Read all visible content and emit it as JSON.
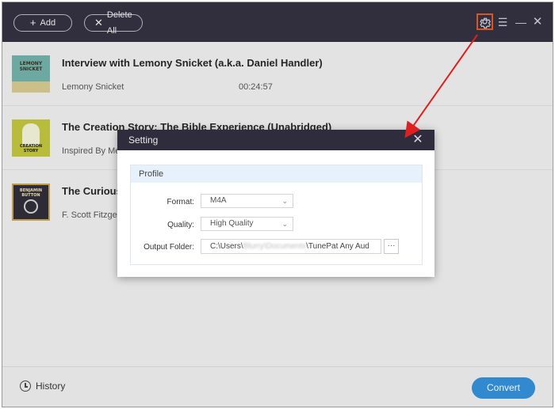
{
  "toolbar": {
    "add_label": "Add",
    "delete_all_label": "Delete All",
    "add_icon": "plus-icon",
    "delete_icon": "x-icon",
    "settings_icon": "gear-icon",
    "menu_icon": "hamburger-icon",
    "minimize_icon": "minimize-icon",
    "close_icon": "close-icon",
    "settings_highlight_color": "#e8561f"
  },
  "tracks": [
    {
      "title": "Interview with Lemony Snicket (a.k.a. Daniel Handler)",
      "author": "Lemony Snicket",
      "duration": "00:24:57",
      "cover_text": "LEMONY SNICKET"
    },
    {
      "title": "The Creation Story: The Bible Experience (Unabridged)",
      "author": "Inspired By Me",
      "duration": "",
      "cover_text": "CREATION STORY"
    },
    {
      "title": "The Curious",
      "author": "F. Scott Fitzgera",
      "duration": "",
      "cover_text": "BENJAMIN BUTTON"
    }
  ],
  "dialog": {
    "title": "Setting",
    "profile_header": "Profile",
    "format_label": "Format:",
    "format_value": "M4A",
    "quality_label": "Quality:",
    "quality_value": "High Quality",
    "output_label": "Output Folder:",
    "output_prefix": "C:\\Users\\",
    "output_blurred": "Blurry\\Documents",
    "output_suffix": "\\TunePat Any Aud",
    "more_label": "···"
  },
  "bottom": {
    "history_label": "History",
    "convert_label": "Convert",
    "convert_color": "#2f8fdb"
  },
  "annotation": {
    "arrow_color": "#e02020"
  }
}
